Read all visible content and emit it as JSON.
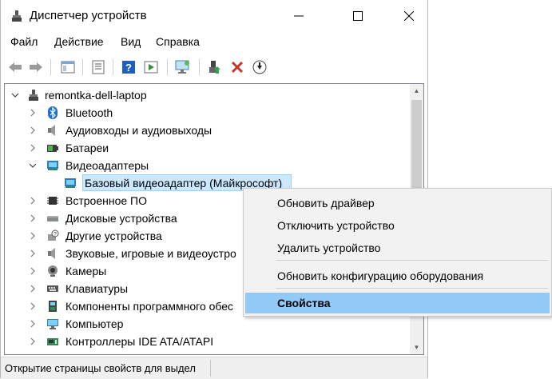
{
  "window": {
    "title": "Диспетчер устройств"
  },
  "menubar": {
    "items": [
      "Файл",
      "Действие",
      "Вид",
      "Справка"
    ]
  },
  "toolbar": {
    "buttons": [
      "back-arrow-icon",
      "forward-arrow-icon",
      "console-tree-icon",
      "properties-icon",
      "help-icon",
      "run-icon",
      "monitor-scan-icon",
      "update-driver-icon",
      "remove-icon",
      "download-icon"
    ]
  },
  "tree": {
    "root": "remontka-dell-laptop",
    "items": [
      {
        "label": "Bluetooth",
        "icon": "bluetooth-icon"
      },
      {
        "label": "Аудиовходы и аудиовыходы",
        "icon": "speaker-icon"
      },
      {
        "label": "Батареи",
        "icon": "battery-icon"
      },
      {
        "label": "Видеоадаптеры",
        "icon": "display-adapter-icon",
        "expanded": true
      },
      {
        "label": "Базовый видеоадаптер (Майкрософт)",
        "icon": "display-adapter-icon",
        "child": true,
        "selected": true
      },
      {
        "label": "Встроенное ПО",
        "icon": "firmware-icon"
      },
      {
        "label": "Дисковые устройства",
        "icon": "disk-icon"
      },
      {
        "label": "Другие устройства",
        "icon": "unknown-device-icon"
      },
      {
        "label": "Звуковые, игровые и видеоустро",
        "icon": "sound-icon"
      },
      {
        "label": "Камеры",
        "icon": "camera-icon"
      },
      {
        "label": "Клавиатуры",
        "icon": "keyboard-icon"
      },
      {
        "label": "Компоненты программного обес",
        "icon": "software-component-icon"
      },
      {
        "label": "Компьютер",
        "icon": "computer-icon"
      },
      {
        "label": "Контроллеры IDE ATA/ATAPI",
        "icon": "ide-controller-icon"
      }
    ]
  },
  "context_menu": {
    "items": [
      {
        "label": "Обновить драйвер"
      },
      {
        "label": "Отключить устройство"
      },
      {
        "label": "Удалить устройство"
      },
      {
        "label": "Обновить конфигурацию оборудования"
      },
      {
        "label": "Свойства",
        "active": true
      }
    ]
  },
  "statusbar": {
    "text": "Открытие страницы свойств для выдел"
  }
}
